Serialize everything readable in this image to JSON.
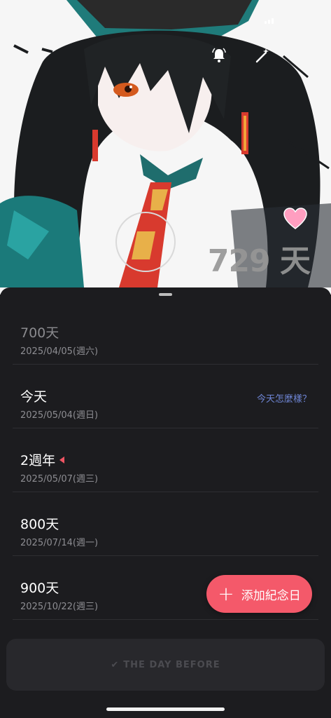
{
  "hero": {
    "days_count": "729 天"
  },
  "events": [
    {
      "title": "700天",
      "date": "2025/04/05(週六)",
      "past": true
    },
    {
      "title": "今天",
      "date": "2025/05/04(週日)",
      "link": "今天怎麼樣？"
    },
    {
      "title": "2週年",
      "date": "2025/05/07(週三)",
      "marker": true
    },
    {
      "title": "800天",
      "date": "2025/07/14(週一)"
    },
    {
      "title": "900天",
      "date": "2025/10/22(週三)"
    }
  ],
  "add_button": {
    "label": "添加紀念日",
    "icon": "plus-icon"
  },
  "footer": {
    "label": "THE DAY BEFORE",
    "icon": "check-icon"
  },
  "icons": {
    "bell": "bell-icon",
    "wand": "magic-wand-icon",
    "heart": "heart-icon"
  },
  "colors": {
    "accent": "#f4596a",
    "link": "#6f86d6",
    "background": "#1c1c1f",
    "heart": "#ff9ec0"
  }
}
